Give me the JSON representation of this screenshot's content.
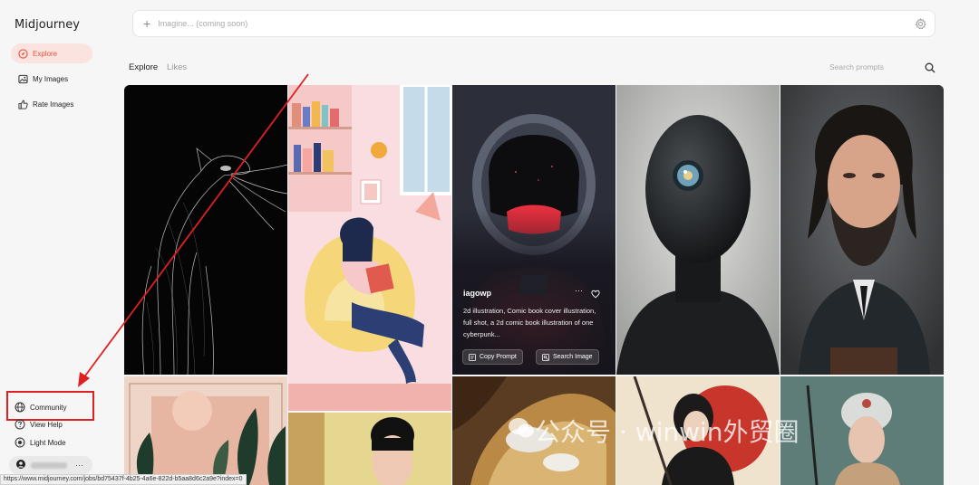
{
  "app": {
    "title": "Midjourney"
  },
  "sidebar": {
    "items": [
      {
        "label": "Explore",
        "icon": "compass-icon",
        "active": true
      },
      {
        "label": "My Images",
        "icon": "image-icon",
        "active": false
      },
      {
        "label": "Rate Images",
        "icon": "thumbs-up-icon",
        "active": false
      }
    ],
    "bottom": [
      {
        "label": "Community",
        "icon": "globe-icon"
      },
      {
        "label": "View Help",
        "icon": "help-circle-icon"
      },
      {
        "label": "Light Mode",
        "icon": "sun-icon"
      }
    ],
    "user_menu": "···"
  },
  "prompt_bar": {
    "placeholder": "Imagine... (coming soon)"
  },
  "tabs": [
    {
      "label": "Explore",
      "active": true
    },
    {
      "label": "Likes",
      "active": false
    }
  ],
  "search": {
    "placeholder": "Search prompts"
  },
  "hover_card": {
    "username": "iagowp",
    "description": "2d illustration, Comic book cover illustration, full shot, a 2d comic book illustration of one cyberpunk...",
    "copy_prompt": "Copy Prompt",
    "search_image": "Search Image",
    "menu": "···"
  },
  "status_url": "https://www.midjourney.com/jobs/bd75437f-4b25-4a6e-822d-b5aa8d6c2a9e?index=0",
  "watermark": "公众号 · winwin外贸圈",
  "colors": {
    "accent": "#e5533f",
    "active_bg": "#fbe3e0",
    "annotation_red": "#e02020"
  }
}
